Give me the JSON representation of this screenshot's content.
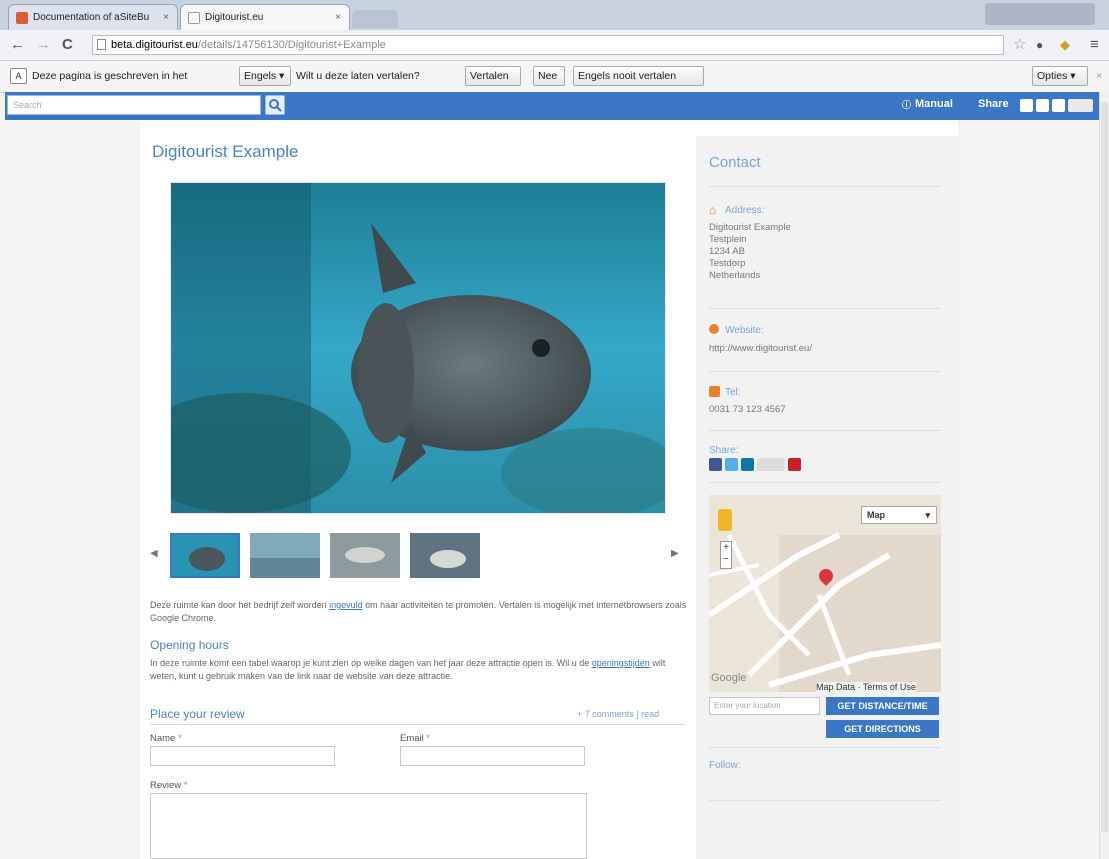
{
  "browser": {
    "tabs": [
      {
        "label": "Documentation of aSiteBu"
      },
      {
        "label": "Digitourist.eu"
      }
    ],
    "url_host": "beta.digitourist.eu",
    "url_path": "/details/14756130/Digitourist+Example"
  },
  "translate_bar": {
    "prefix": "Deze pagina is geschreven in het",
    "language": "Engels",
    "question": "Wilt u deze laten vertalen?",
    "translate_btn": "Vertalen",
    "no_btn": "Nee",
    "never_btn": "Engels nooit vertalen",
    "options_btn": "Opties"
  },
  "site_header": {
    "search_placeholder": "Search",
    "manual": "Manual",
    "share": "Share"
  },
  "main": {
    "title": "Digitourist Example",
    "description": "Deze ruimte kan door het bedrijf zelf worden ingevuld om haar activiteiten te promoten. Vertalen is mogelijk met internetbrowsers zoals Google Chrome.",
    "description_link": "ingevuld",
    "opening_title": "Opening hours",
    "opening_text": "In deze ruimte komt een tabel waarop je kunt zien op welke dagen van het jaar deze attractie open is. Wil u de openingstijden wilt weten, kunt u gebruik maken van de link naar de website van deze attractie.",
    "opening_link": "openingstijden",
    "review_title": "Place your review",
    "comments_link": "+ 7 comments | read",
    "name_label": "Name",
    "email_label": "Email",
    "review_label": "Review",
    "required_mark": "*"
  },
  "contact": {
    "title": "Contact",
    "address_label": "Address:",
    "address_lines": [
      "Digitourist Example",
      "Testplein",
      "1234 AB",
      "Testdorp",
      "Netherlands"
    ],
    "website_label": "Website:",
    "website_value": "http://www.digitourist.eu/",
    "tel_label": "Tel:",
    "tel_value": "0031 73 123 4567",
    "share_label": "Share:",
    "follow_label": "Follow:"
  },
  "map": {
    "type_select": "Map",
    "logo": "Google",
    "map_data": "Map Data",
    "terms": "Terms of Use",
    "location_placeholder": "Enter your location",
    "distance_btn": "GET DISTANCE/TIME",
    "directions_btn": "GET DIRECTIONS"
  }
}
